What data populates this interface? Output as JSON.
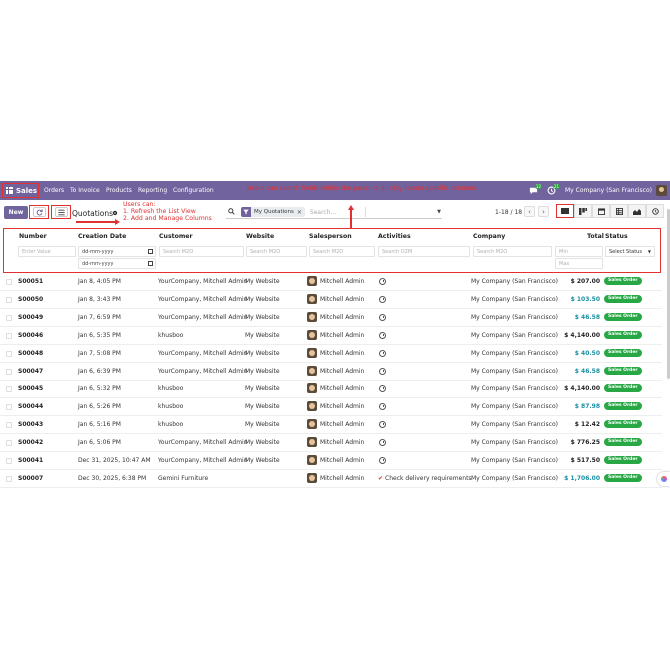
{
  "navbar": {
    "app_name": "Sales",
    "menu": [
      "Orders",
      "To Invoice",
      "Products",
      "Reporting",
      "Configuration"
    ],
    "annotation": "Users can search fields within the panel to quickly locate specific columns",
    "messages_count": "12",
    "activities_count": "21",
    "company": "My Company (San Francisco)"
  },
  "control": {
    "new_label": "New",
    "breadcrumb": "Quotations",
    "annotation_lines": [
      "Users can:",
      "1. Refresh the List View",
      "2. Add and Manage Columns"
    ],
    "facet_label": "My Quotations",
    "search_placeholder": "Search...",
    "pager": "1-18 / 18"
  },
  "columns": {
    "number": "Number",
    "creation_date": "Creation Date",
    "customer": "Customer",
    "website": "Website",
    "salesperson": "Salesperson",
    "activities": "Activities",
    "company": "Company",
    "total": "Total",
    "status": "Status"
  },
  "filters": {
    "number": "Enter Value",
    "date_from": "dd-mm-yyyy",
    "date_to": "dd-mm-yyyy",
    "customer": "Search M2O",
    "website": "Search M2O",
    "salesperson": "Search M2O",
    "activities": "Search O2M",
    "company": "Search M2O",
    "total_min": "Min",
    "total_max": "Max",
    "status": "Select Status"
  },
  "rows": [
    {
      "number": "S00051",
      "date": "Jan 8, 4:05 PM",
      "customer": "YourCompany, Mitchell Admin",
      "website": "My Website",
      "salesperson": "Mitchell Admin",
      "activity": "",
      "company": "My Company (San Francisco)",
      "total": "$ 207.00",
      "total_color": "#222222",
      "status": "Sales Order"
    },
    {
      "number": "S00050",
      "date": "Jan 8, 3:43 PM",
      "customer": "YourCompany, Mitchell Admin",
      "website": "My Website",
      "salesperson": "Mitchell Admin",
      "activity": "",
      "company": "My Company (San Francisco)",
      "total": "$ 103.50",
      "total_color": "#1a8fa3",
      "status": "Sales Order"
    },
    {
      "number": "S00049",
      "date": "Jan 7, 6:59 PM",
      "customer": "YourCompany, Mitchell Admin",
      "website": "My Website",
      "salesperson": "Mitchell Admin",
      "activity": "",
      "company": "My Company (San Francisco)",
      "total": "$ 46.58",
      "total_color": "#1a8fa3",
      "status": "Sales Order"
    },
    {
      "number": "S00046",
      "date": "Jan 6, 5:35 PM",
      "customer": "khusboo",
      "website": "My Website",
      "salesperson": "Mitchell Admin",
      "activity": "",
      "company": "My Company (San Francisco)",
      "total": "$ 4,140.00",
      "total_color": "#222222",
      "status": "Sales Order"
    },
    {
      "number": "S00048",
      "date": "Jan 7, 5:08 PM",
      "customer": "YourCompany, Mitchell Admin",
      "website": "My Website",
      "salesperson": "Mitchell Admin",
      "activity": "",
      "company": "My Company (San Francisco)",
      "total": "$ 40.50",
      "total_color": "#1a8fa3",
      "status": "Sales Order"
    },
    {
      "number": "S00047",
      "date": "Jan 6, 6:39 PM",
      "customer": "YourCompany, Mitchell Admin",
      "website": "My Website",
      "salesperson": "Mitchell Admin",
      "activity": "",
      "company": "My Company (San Francisco)",
      "total": "$ 46.58",
      "total_color": "#1a8fa3",
      "status": "Sales Order"
    },
    {
      "number": "S00045",
      "date": "Jan 6, 5:32 PM",
      "customer": "khusboo",
      "website": "My Website",
      "salesperson": "Mitchell Admin",
      "activity": "",
      "company": "My Company (San Francisco)",
      "total": "$ 4,140.00",
      "total_color": "#222222",
      "status": "Sales Order"
    },
    {
      "number": "S00044",
      "date": "Jan 6, 5:26 PM",
      "customer": "khusboo",
      "website": "My Website",
      "salesperson": "Mitchell Admin",
      "activity": "",
      "company": "My Company (San Francisco)",
      "total": "$ 87.98",
      "total_color": "#1a8fa3",
      "status": "Sales Order"
    },
    {
      "number": "S00043",
      "date": "Jan 6, 5:16 PM",
      "customer": "khusboo",
      "website": "My Website",
      "salesperson": "Mitchell Admin",
      "activity": "",
      "company": "My Company (San Francisco)",
      "total": "$ 12.42",
      "total_color": "#222222",
      "status": "Sales Order"
    },
    {
      "number": "S00042",
      "date": "Jan 6, 5:06 PM",
      "customer": "YourCompany, Mitchell Admin",
      "website": "My Website",
      "salesperson": "Mitchell Admin",
      "activity": "",
      "company": "My Company (San Francisco)",
      "total": "$ 776.25",
      "total_color": "#222222",
      "status": "Sales Order"
    },
    {
      "number": "S00041",
      "date": "Dec 31, 2025, 10:47 AM",
      "customer": "YourCompany, Mitchell Admin",
      "website": "My Website",
      "salesperson": "Mitchell Admin",
      "activity": "",
      "company": "My Company (San Francisco)",
      "total": "$ 517.50",
      "total_color": "#222222",
      "status": "Sales Order"
    },
    {
      "number": "S00007",
      "date": "Dec 30, 2025, 6:38 PM",
      "customer": "Gemini Furniture",
      "website": "",
      "salesperson": "Mitchell Admin",
      "activity": "Check delivery requirements",
      "company": "My Company (San Francisco)",
      "total": "$ 1,706.00",
      "total_color": "#1a8fa3",
      "status": "Sales Order"
    }
  ],
  "colors": {
    "brand": "#71639e",
    "annotation": "#e03030",
    "status_green": "#28a745"
  }
}
